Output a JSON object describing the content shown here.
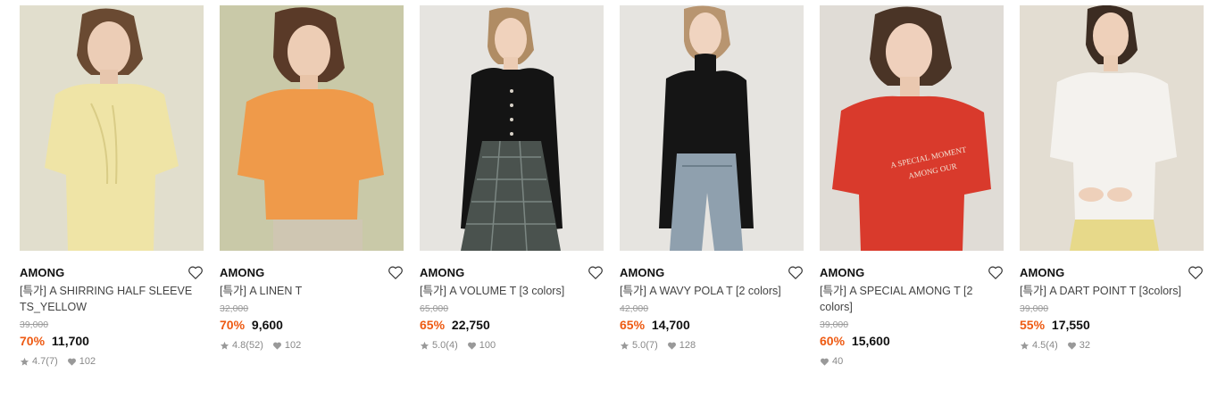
{
  "products": [
    {
      "brand": "AMONG",
      "name": "[특가] A SHIRRING HALF SLEEVE TS_YELLOW",
      "original_price": "39,000",
      "discount": "70%",
      "price": "11,700",
      "rating": "4.7",
      "reviews": "(7)",
      "likes": "102",
      "bg_color": "#e4e1d2",
      "shirt_color": "#efe4a6"
    },
    {
      "brand": "AMONG",
      "name": "[특가] A LINEN T",
      "original_price": "32,000",
      "discount": "70%",
      "price": "9,600",
      "rating": "4.8",
      "reviews": "(52)",
      "likes": "102",
      "bg_color": "#c9c9a8",
      "shirt_color": "#ef9a4a"
    },
    {
      "brand": "AMONG",
      "name": "[특가] A VOLUME T [3 colors]",
      "original_price": "65,000",
      "discount": "65%",
      "price": "22,750",
      "rating": "5.0",
      "reviews": "(4)",
      "likes": "100",
      "bg_color": "#e6e4e0",
      "shirt_color": "#141414"
    },
    {
      "brand": "AMONG",
      "name": "[특가] A WAVY POLA T [2 colors]",
      "original_price": "42,000",
      "discount": "65%",
      "price": "14,700",
      "rating": "5.0",
      "reviews": "(7)",
      "likes": "128",
      "bg_color": "#e6e4e0",
      "shirt_color": "#151515"
    },
    {
      "brand": "AMONG",
      "name": "[특가] A SPECIAL AMONG T [2 colors]",
      "original_price": "39,000",
      "discount": "60%",
      "price": "15,600",
      "rating": "",
      "reviews": "",
      "likes": "40",
      "bg_color": "#e0dcd6",
      "shirt_color": "#d93a2c",
      "print_line1": "A SPECIAL MOMENT",
      "print_line2": "AMONG OUR"
    },
    {
      "brand": "AMONG",
      "name": "[특가] A DART POINT T [3colors]",
      "original_price": "39,000",
      "discount": "55%",
      "price": "17,550",
      "rating": "4.5",
      "reviews": "(4)",
      "likes": "32",
      "bg_color": "#e3ddd2",
      "shirt_color": "#f4f2ee"
    }
  ],
  "colors": {
    "discount": "#ee5a12",
    "strike": "#9a9a9a"
  },
  "icons": {
    "wishlist": "heart-outline-icon",
    "rating": "star-icon",
    "likes": "heart-filled-icon"
  }
}
